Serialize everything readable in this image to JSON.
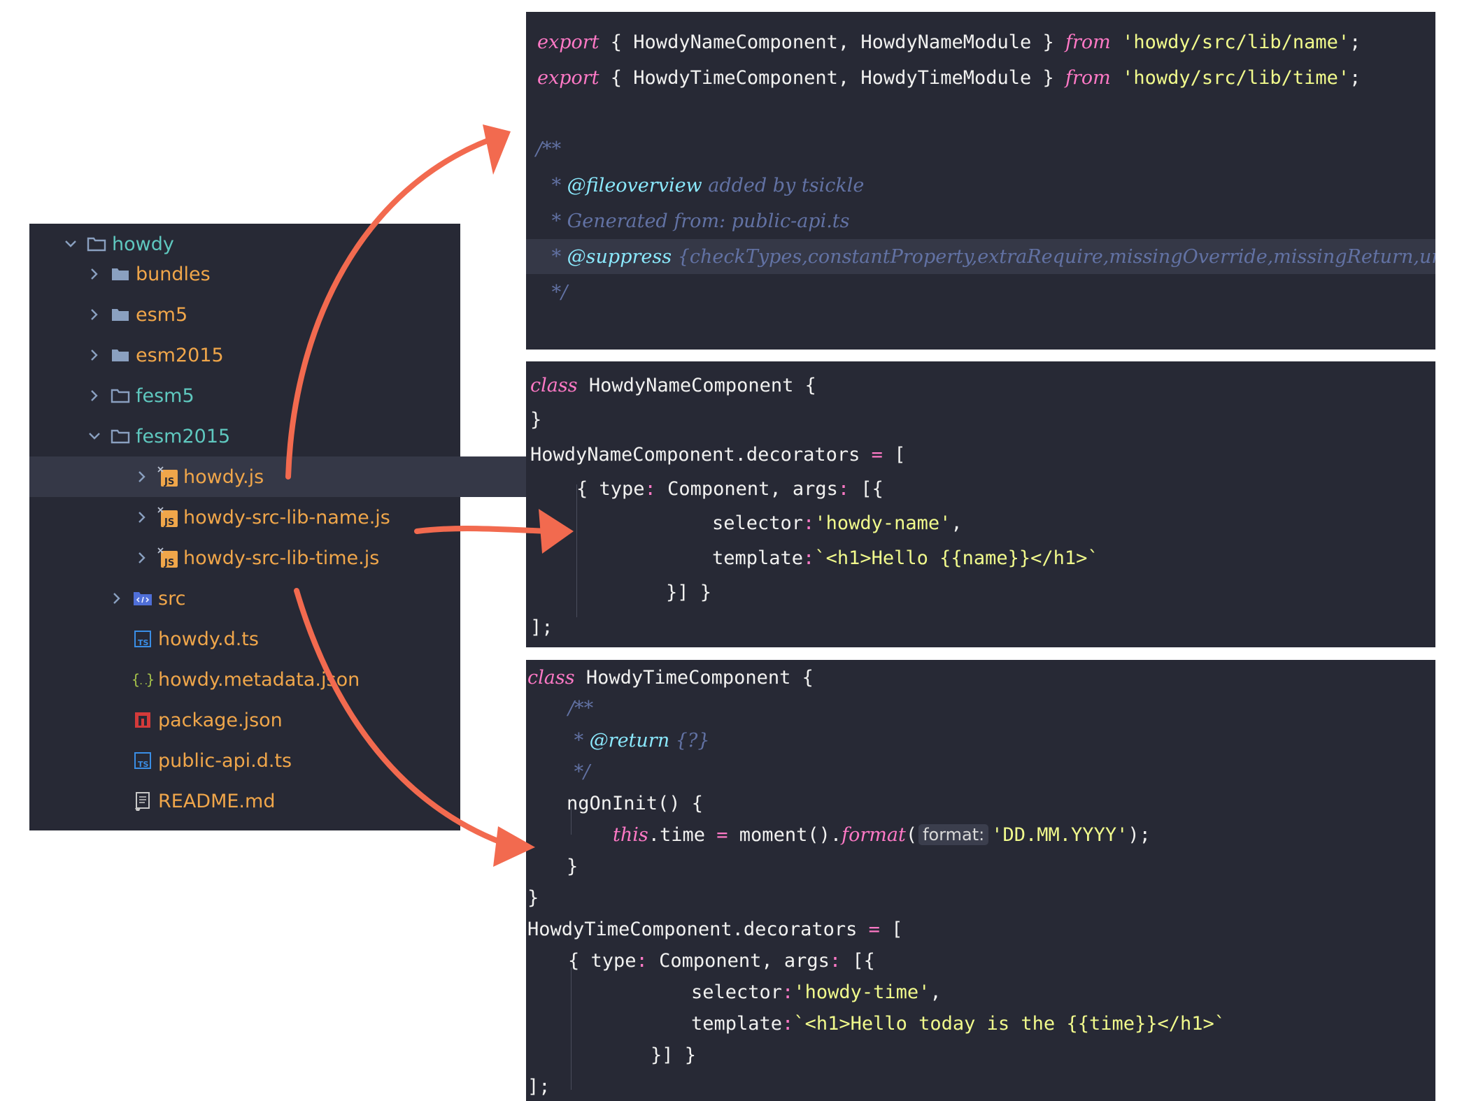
{
  "file_tree": {
    "items": [
      {
        "id": "howdy",
        "label": "howdy",
        "icon": "folder-outline-icon",
        "expanded": true,
        "color": "#5fc8bf"
      },
      {
        "id": "bundles",
        "label": "bundles",
        "icon": "folder-filled-icon",
        "expanded": false,
        "color": "#f0a64a"
      },
      {
        "id": "esm5",
        "label": "esm5",
        "icon": "folder-filled-icon",
        "expanded": false,
        "color": "#f0a64a"
      },
      {
        "id": "esm2015",
        "label": "esm2015",
        "icon": "folder-filled-icon",
        "expanded": false,
        "color": "#f0a64a"
      },
      {
        "id": "fesm5",
        "label": "fesm5",
        "icon": "folder-outline-icon",
        "expanded": false,
        "color": "#5fc8bf"
      },
      {
        "id": "fesm2015",
        "label": "fesm2015",
        "icon": "folder-outline-icon",
        "expanded": true,
        "color": "#5fc8bf"
      },
      {
        "id": "howdy-js",
        "label": "howdy.js",
        "icon": "js-file-icon",
        "selected": true,
        "color": "#f0a64a"
      },
      {
        "id": "howdy-src-lib-name-js",
        "label": "howdy-src-lib-name.js",
        "icon": "js-file-icon",
        "color": "#f0a64a"
      },
      {
        "id": "howdy-src-lib-time-js",
        "label": "howdy-src-lib-time.js",
        "icon": "js-file-icon",
        "color": "#f0a64a"
      },
      {
        "id": "src",
        "label": "src",
        "icon": "source-folder-icon",
        "expanded": false,
        "color": "#f0a64a"
      },
      {
        "id": "howdy-d-ts",
        "label": "howdy.d.ts",
        "icon": "ts-file-icon",
        "color": "#f0a64a"
      },
      {
        "id": "howdy-metadata-json",
        "label": "howdy.metadata.json",
        "icon": "json-file-icon",
        "color": "#f0a64a"
      },
      {
        "id": "package-json",
        "label": "package.json",
        "icon": "npm-icon",
        "color": "#f0a64a"
      },
      {
        "id": "public-api-d-ts",
        "label": "public-api.d.ts",
        "icon": "ts-file-icon",
        "color": "#f0a64a"
      },
      {
        "id": "readme-md",
        "label": "README.md",
        "icon": "readme-icon",
        "color": "#f0a64a"
      }
    ]
  },
  "panel1": {
    "t": {
      "export": "export",
      "open": " { ",
      "from": "from",
      "names1": "HowdyNameComponent, HowdyNameModule",
      "close": " } ",
      "path1": "'howdy/src/lib/name'",
      "semi": ";",
      "names2": "HowdyTimeComponent, HowdyTimeModule",
      "path2": "'howdy/src/lib/time'",
      "doc_open": "/**",
      "star": " * ",
      "fileoverview": "@fileoverview",
      "added_by": " added by tsickle",
      "generated": "Generated from: public-api.ts",
      "suppress": "@suppress",
      "sp": " ",
      "suppress_list": "{checkTypes,constantProperty,extraRequire,missingOverride,missingReturn,unusedPrivateMembers,uselessCode}",
      "doc_close": " */",
      "next_doc": "/**"
    }
  },
  "panel2": {
    "t": {
      "class": "class",
      "name": " HowdyNameComponent {",
      "rbrace": "}",
      "decor": "HowdyNameComponent.decorators",
      "eq": " = ",
      "lbrack": "[",
      "type_open": "{ type",
      "colon": ":",
      "component": " Component, args",
      "args_open": " [{",
      "selector": "selector",
      "selector_val": "'howdy-name'",
      "comma": ",",
      "template": "template",
      "template_val": "`<h1>Hello {{name}}</h1>`",
      "close_args": "}] }",
      "end": "];"
    }
  },
  "panel3": {
    "t": {
      "class": "class",
      "name": " HowdyTimeComponent {",
      "doc_open": "/**",
      "return_star": " * ",
      "return_tag": "@return",
      "return_type": " {?}",
      "doc_close": " */",
      "ngoninit": "ngOnInit() {",
      "this": "this",
      "time": ".time",
      "eq": " = ",
      "moment": "moment().",
      "format": "format",
      "lparen": "(",
      "hint": "format:",
      "format_val": "'DD.MM.YYYY'",
      "rparen_semi": ");",
      "rbrace": "}",
      "decor": "HowdyTimeComponent.decorators",
      "lbrack": "[",
      "type_open": "{ type",
      "colon": ":",
      "component": " Component, args",
      "args_open": " [{",
      "selector": "selector",
      "selector_val": "'howdy-time'",
      "comma": ",",
      "template": "template",
      "template_val": "`<h1>Hello today is the {{time}}</h1>`",
      "close_args": "}] }",
      "end": "];"
    }
  },
  "colors": {
    "editor_bg": "#272935",
    "selection": "#353847",
    "arrow": "#f26a4f",
    "keyword": "#ff79c6",
    "string": "#f1fa8c",
    "comment": "#6272a4",
    "doc_tag": "#8be9fd"
  }
}
